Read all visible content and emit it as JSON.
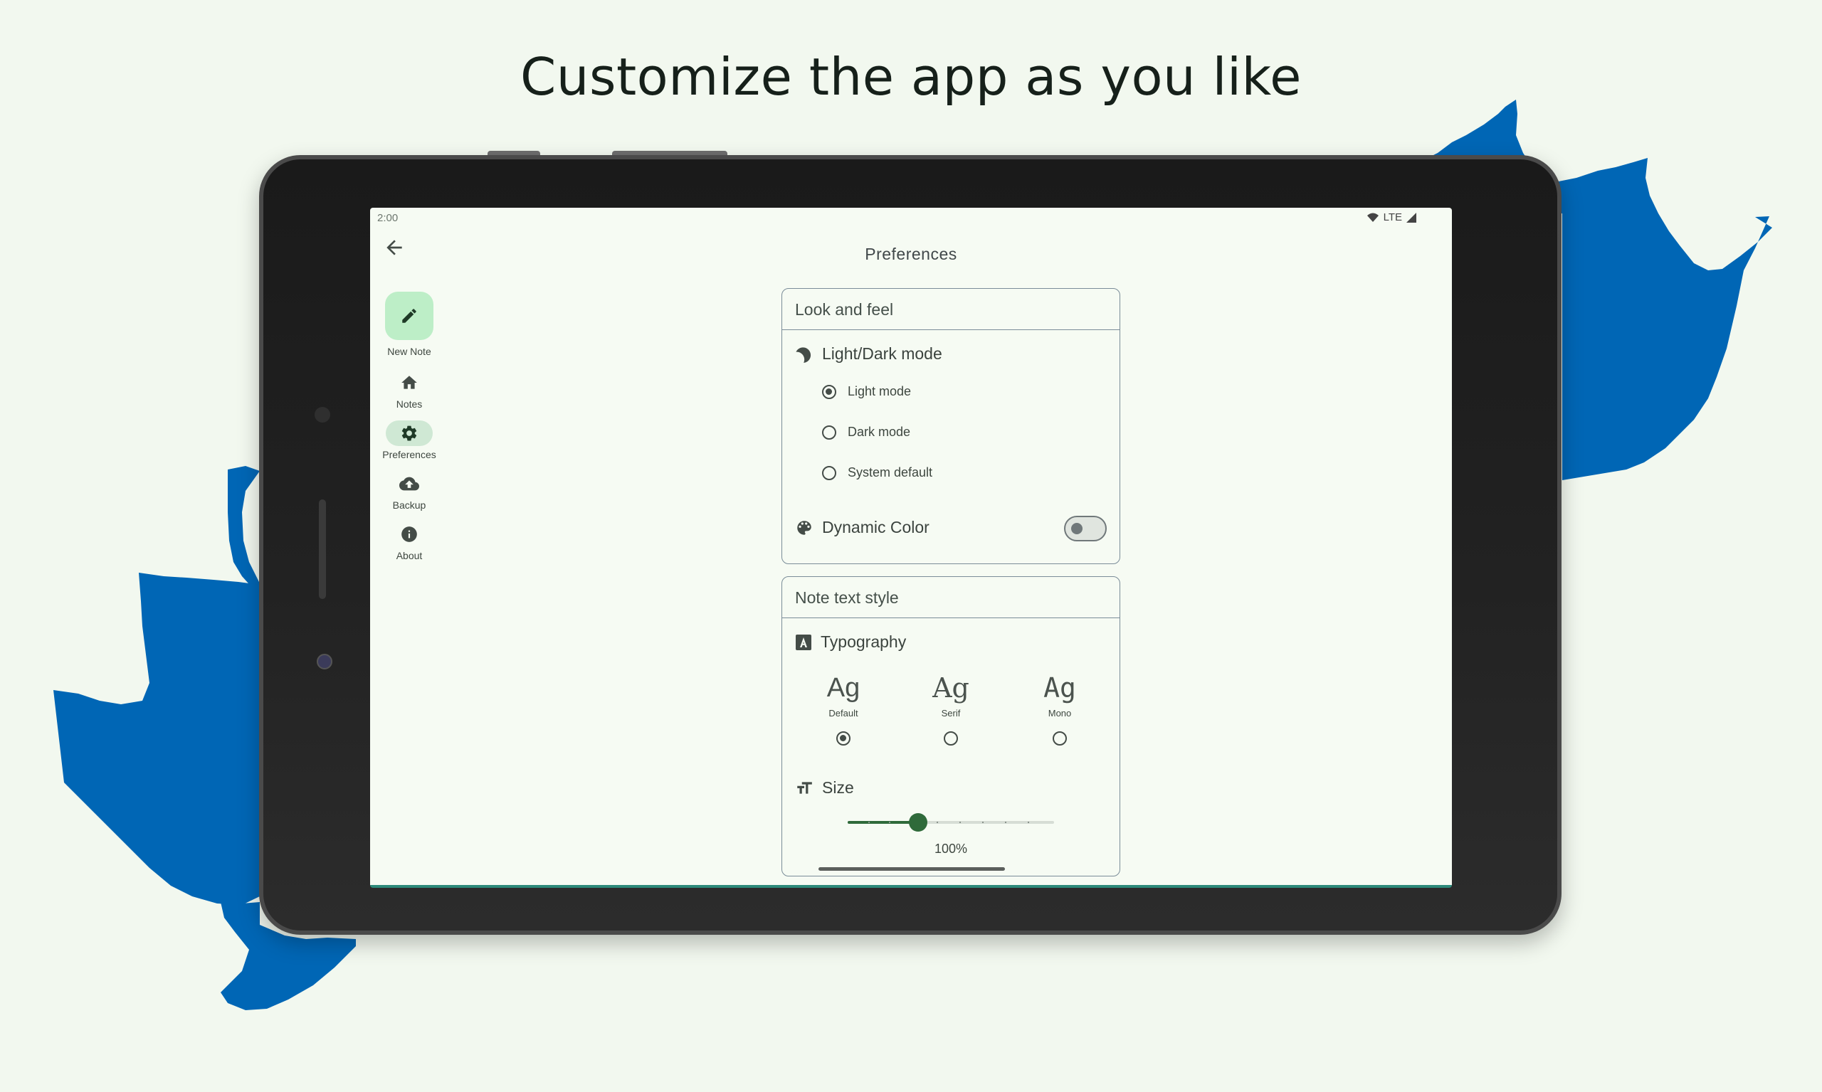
{
  "headline": "Customize the app as you like",
  "status_bar": {
    "time": "2:00",
    "network": "LTE"
  },
  "app_bar": {
    "title": "Preferences"
  },
  "nav_rail": {
    "new_note": "New Note",
    "items": [
      {
        "label": "Notes",
        "icon": "home-icon"
      },
      {
        "label": "Preferences",
        "icon": "gear-icon",
        "active": true
      },
      {
        "label": "Backup",
        "icon": "cloud-upload-icon"
      },
      {
        "label": "About",
        "icon": "info-icon"
      }
    ]
  },
  "look_and_feel": {
    "header": "Look and feel",
    "mode_title": "Light/Dark mode",
    "options": [
      "Light mode",
      "Dark mode",
      "System default"
    ],
    "selected": "Light mode",
    "dynamic_color_label": "Dynamic Color",
    "dynamic_color_on": false
  },
  "note_text_style": {
    "header": "Note text style",
    "typography_title": "Typography",
    "fonts": [
      {
        "sample": "Ag",
        "name": "Default",
        "selected": true
      },
      {
        "sample": "Ag",
        "name": "Serif",
        "selected": false
      },
      {
        "sample": "Ag",
        "name": "Mono",
        "selected": false
      }
    ],
    "size_title": "Size",
    "size_value": "100%",
    "size_fraction": 0.34
  },
  "colors": {
    "accent": "#2f6a3a",
    "decor_blue": "#0066b5",
    "fab": "#bdeec7"
  }
}
